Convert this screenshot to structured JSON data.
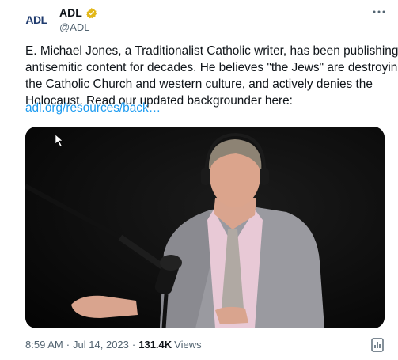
{
  "author": {
    "avatar_text": "ADL",
    "display_name": "ADL",
    "handle": "@ADL",
    "verified_color": "#e2b719"
  },
  "tweet": {
    "lines": [
      "E. Michael Jones, a Traditionalist Catholic writer, has been publishing",
      "antisemitic content for decades. He believes \"the Jews\" are destroying",
      "the Catholic Church and western culture, and actively denies the",
      "Holocaust. Read our updated backgrounder here:"
    ],
    "link_text": "adl.org/resources/back…"
  },
  "meta": {
    "time": "8:59 AM",
    "date": "Jul 14, 2023",
    "separator": "·",
    "views_count": "131.4K",
    "views_label": "Views"
  },
  "icons": {
    "more": "more-options-icon",
    "verified": "verified-badge-icon",
    "analytics": "analytics-icon"
  },
  "colors": {
    "link": "#1d9bf0",
    "secondary_text": "#536471"
  }
}
